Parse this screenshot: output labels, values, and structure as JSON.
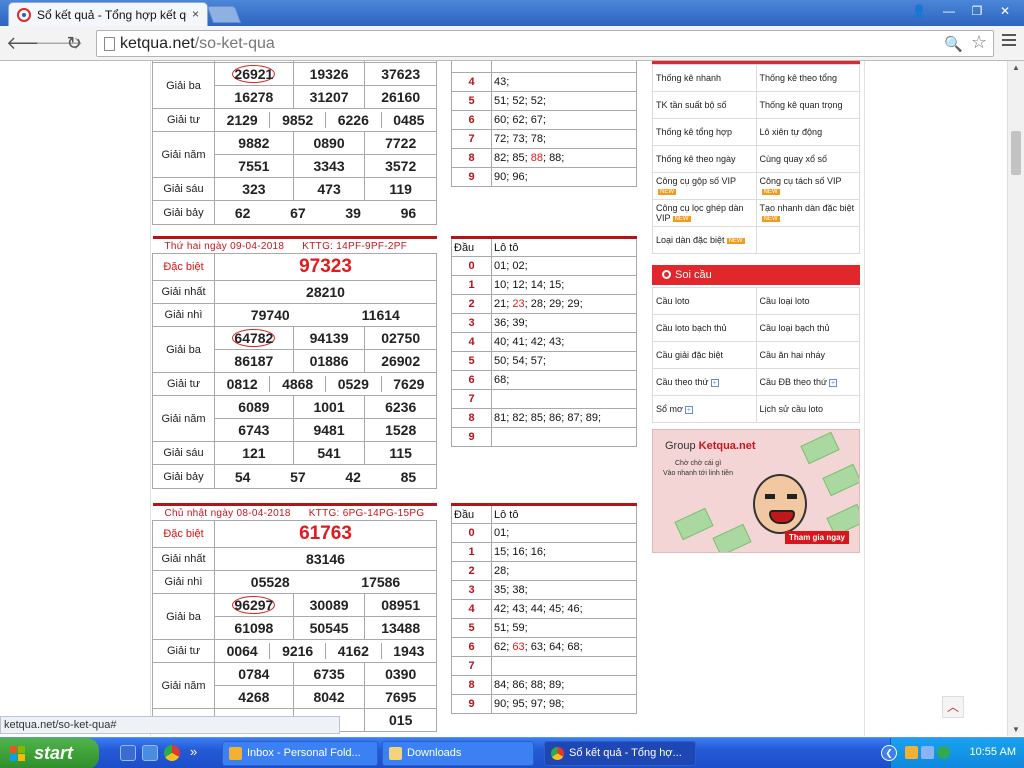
{
  "browser": {
    "tab_title": "Sổ kết quả - Tổng hợp kết qu",
    "tab_close": "×",
    "url_host": "ketqua.net",
    "url_path": "/so-ket-qua",
    "status_url": "ketqua.net/so-ket-qua#",
    "icons": [
      "back-arrow-icon",
      "forward-arrow-icon",
      "reload-icon",
      "page-icon",
      "zoom-icon",
      "star-icon",
      "menu-icon",
      "user-icon",
      "minimize-icon",
      "maximize-icon",
      "close-icon"
    ]
  },
  "glyphs": {
    "back": "🡐",
    "fwd": "🡒",
    "reload": "↻",
    "zoom": "🔍",
    "star": "☆",
    "user": "👤",
    "min": "—",
    "max": "❐",
    "close": "✕",
    "up": "▲",
    "down": "▼",
    "totop": "︿"
  },
  "block1": {
    "rows": [
      {
        "label": "Giải ba",
        "cells": [
          "26921",
          "19326",
          "37623"
        ]
      },
      {
        "label": "",
        "cells": [
          "16278",
          "31207",
          "26160"
        ]
      },
      {
        "label": "Giải tư",
        "cells": [
          "2129",
          "9852",
          "6226",
          "0485"
        ]
      },
      {
        "label": "Giải năm",
        "cells": [
          "9882",
          "0890",
          "7722"
        ]
      },
      {
        "label": "",
        "cells": [
          "7551",
          "3343",
          "3572"
        ]
      },
      {
        "label": "Giải sáu",
        "cells": [
          "323",
          "473",
          "119"
        ]
      },
      {
        "label": "Giải bảy",
        "cells": [
          "62",
          "67",
          "39",
          "96"
        ]
      }
    ],
    "loto": [
      {
        "dau": "4",
        "lt": "43;"
      },
      {
        "dau": "5",
        "lt": "51; 52; 52;"
      },
      {
        "dau": "6",
        "lt": "60; 62; 67;"
      },
      {
        "dau": "7",
        "lt": "72; 73; 78;"
      },
      {
        "dau": "8",
        "lt_pre": "82; 85; ",
        "lt_hot": "88",
        "lt_post": "; 88;"
      },
      {
        "dau": "9",
        "lt": "90; 96;"
      }
    ]
  },
  "block2": {
    "date": "Thứ hai ngày 09-04-2018",
    "kttg": "KTTG: 14PF-9PF-2PF",
    "special_label": "Đặc biệt",
    "special": "97323",
    "first_label": "Giải nhất",
    "first": "28210",
    "second_label": "Giải nhì",
    "second": [
      "79740",
      "11614"
    ],
    "third_label": "Giải ba",
    "third": [
      "64782",
      "94139",
      "02750",
      "86187",
      "01886",
      "26902"
    ],
    "fourth_label": "Giải tư",
    "fourth": [
      "0812",
      "4868",
      "0529",
      "7629"
    ],
    "fifth_label": "Giải năm",
    "fifth": [
      "6089",
      "1001",
      "6236",
      "6743",
      "9481",
      "1528"
    ],
    "sixth_label": "Giải sáu",
    "sixth": [
      "121",
      "541",
      "115"
    ],
    "seventh_label": "Giải bảy",
    "seventh": [
      "54",
      "57",
      "42",
      "85"
    ],
    "loto_head": [
      "Đầu",
      "Lô tô"
    ],
    "loto": [
      {
        "dau": "0",
        "lt": "01; 02;"
      },
      {
        "dau": "1",
        "lt": "10; 12; 14; 15;"
      },
      {
        "dau": "2",
        "lt_pre": "21; ",
        "lt_hot": "23",
        "lt_post": "; 28; 29; 29;"
      },
      {
        "dau": "3",
        "lt": "36; 39;"
      },
      {
        "dau": "4",
        "lt": "40; 41; 42; 43;"
      },
      {
        "dau": "5",
        "lt": "50; 54; 57;"
      },
      {
        "dau": "6",
        "lt": "68;"
      },
      {
        "dau": "7",
        "lt": ""
      },
      {
        "dau": "8",
        "lt": "81; 82; 85; 86; 87; 89;"
      },
      {
        "dau": "9",
        "lt": ""
      }
    ]
  },
  "block3": {
    "date": "Chủ nhật ngày 08-04-2018",
    "kttg": "KTTG: 6PG-14PG-15PG",
    "special_label": "Đặc biệt",
    "special": "61763",
    "first_label": "Giải nhất",
    "first": "83146",
    "second_label": "Giải nhì",
    "second": [
      "05528",
      "17586"
    ],
    "third_label": "Giải ba",
    "third": [
      "96297",
      "30089",
      "08951",
      "61098",
      "50545",
      "13488"
    ],
    "fourth_label": "Giải tư",
    "fourth": [
      "0064",
      "9216",
      "4162",
      "1943"
    ],
    "fifth_label": "Giải năm",
    "fifth": [
      "0784",
      "6735",
      "0390",
      "4268",
      "8042",
      "7695"
    ],
    "sixth_partial": "015",
    "loto_head": [
      "Đầu",
      "Lô tô"
    ],
    "loto": [
      {
        "dau": "0",
        "lt": "01;"
      },
      {
        "dau": "1",
        "lt": "15; 16; 16;"
      },
      {
        "dau": "2",
        "lt": "28;"
      },
      {
        "dau": "3",
        "lt": "35; 38;"
      },
      {
        "dau": "4",
        "lt": "42; 43; 44; 45; 46;"
      },
      {
        "dau": "5",
        "lt": "51; 59;"
      },
      {
        "dau": "6",
        "lt_pre": "62; ",
        "lt_hot": "63",
        "lt_post": "; 63; 64; 68;"
      },
      {
        "dau": "7",
        "lt": ""
      },
      {
        "dau": "8",
        "lt": "84; 86; 88; 89;"
      },
      {
        "dau": "9",
        "lt": "90; 95; 97; 98;"
      }
    ]
  },
  "sidebar": {
    "thongke": [
      [
        "Thống kê nhanh",
        "Thống kê theo tổng"
      ],
      [
        "TK tần suất bộ số",
        "Thống kê quan trọng"
      ],
      [
        "Thống kê tổng hợp",
        "Lô xiên tự động"
      ],
      [
        "Thống kê theo ngày",
        "Cùng quay xổ số"
      ],
      [
        "Công cụ gộp số VIP",
        "Công cụ tách số VIP"
      ],
      [
        "Công cụ lọc ghép dàn VIP",
        "Tạo nhanh dàn đặc biệt"
      ],
      [
        "Loại dàn đặc biệt",
        ""
      ]
    ],
    "badge": "NEW",
    "soicau_title": "Soi cầu",
    "soicau": [
      [
        "Cầu loto",
        "Cầu loại loto"
      ],
      [
        "Cầu loto bạch thủ",
        "Cầu loại bạch thủ"
      ],
      [
        "Cầu giải đặc biệt",
        "Cầu ăn hai nháy"
      ],
      [
        "Cầu theo thứ",
        "Cầu ĐB theo thứ"
      ],
      [
        "Sổ mơ",
        "Lịch sử cầu loto"
      ]
    ],
    "plus": "+",
    "banner_group": "Group",
    "banner_brand": "Ketqua.net",
    "banner_line1": "Chờ chờ cái gì",
    "banner_line2": "Vào nhanh tới linh tiền",
    "banner_join": "Tham gia ngay"
  },
  "taskbar": {
    "start": "start",
    "tasks": [
      "Inbox - Personal Fold...",
      "Downloads",
      "Sổ kết quả - Tổng hợ..."
    ],
    "more": "»",
    "clock": "10:55 AM",
    "collapse": "❮"
  },
  "colors": {
    "accent_red": "#e01b1b",
    "dark_red": "#b3141a",
    "xp_blue": "#2459d6",
    "xp_green": "#2f8e2b"
  }
}
